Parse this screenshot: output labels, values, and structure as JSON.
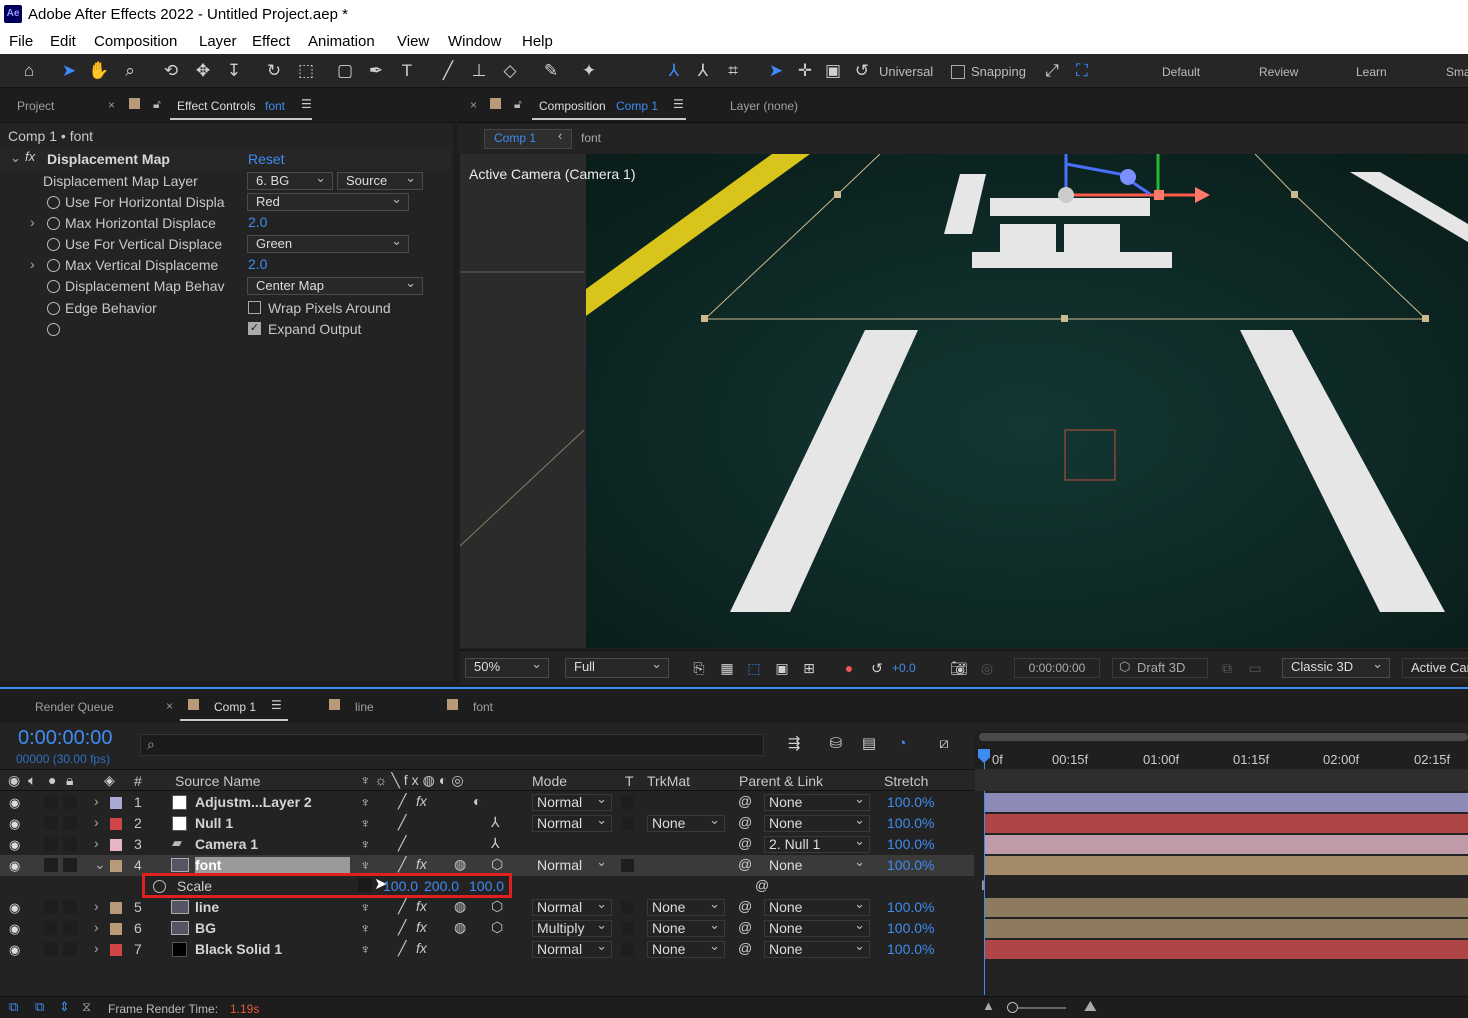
{
  "window": {
    "title": "Adobe After Effects 2022 - Untitled Project.aep *",
    "app_icon": "Ae"
  },
  "menu": [
    "File",
    "Edit",
    "Composition",
    "Layer",
    "Effect",
    "Animation",
    "View",
    "Window",
    "Help"
  ],
  "toolbar": {
    "axis_mode": "Universal",
    "snapping": "Snapping",
    "workspaces": [
      "Default",
      "Review",
      "Learn",
      "Sma"
    ]
  },
  "left_panel": {
    "tab_project": "Project",
    "tab_effect_controls": "Effect Controls",
    "tab_effect_layer": "font",
    "breadcrumb": "Comp 1 • font",
    "effect_name": "Displacement Map",
    "reset": "Reset",
    "props": [
      {
        "label": "Displacement Map Layer",
        "value": "6. BG",
        "extra": "Source"
      },
      {
        "label": "Use For Horizontal Displa",
        "value": "Red"
      },
      {
        "label": "Max Horizontal Displace",
        "value": "2.0"
      },
      {
        "label": "Use For Vertical Displace",
        "value": "Green"
      },
      {
        "label": "Max Vertical Displaceme",
        "value": "2.0"
      },
      {
        "label": "Displacement Map Behav",
        "value": "Center Map"
      },
      {
        "label": "Edge Behavior",
        "value": "Wrap Pixels Around"
      },
      {
        "label": "",
        "value": "Expand Output"
      }
    ]
  },
  "comp_panel": {
    "tab_label": "Composition",
    "tab_comp": "Comp 1",
    "layer_tab": "Layer (none)",
    "crumb_comp": "Comp 1",
    "crumb_layer": "font",
    "camera_label": "Active Camera (Camera 1)",
    "zoom": "50%",
    "resolution": "Full",
    "exposure": "+0.0",
    "timecode": "0:00:00:00",
    "draft": "Draft 3D",
    "renderer": "Classic 3D",
    "view": "Active Cam"
  },
  "timeline": {
    "tabs": [
      "Render Queue",
      "Comp 1",
      "line",
      "font"
    ],
    "timecode": "0:00:00:00",
    "frames": "00000 (30.00 fps)",
    "columns": {
      "num": "#",
      "source": "Source Name",
      "mode": "Mode",
      "t": "T",
      "trkmat": "TrkMat",
      "parent": "Parent & Link",
      "stretch": "Stretch"
    },
    "ruler": [
      "0f",
      "00:15f",
      "01:00f",
      "01:15f",
      "02:00f",
      "02:15f"
    ],
    "layers": [
      {
        "num": "1",
        "name": "Adjustm...Layer 2",
        "color": "#a9a9d6",
        "icon": "#ffffff",
        "mode": "Normal",
        "trkmat": "",
        "parent": "None",
        "stretch": "100.0%",
        "bar": "#8b8bb5"
      },
      {
        "num": "2",
        "name": "Null 1",
        "color": "#d04545",
        "icon": "#ffffff",
        "mode": "Normal",
        "trkmat": "None",
        "parent": "None",
        "stretch": "100.0%",
        "bar": "#b04545"
      },
      {
        "num": "3",
        "name": "Camera 1",
        "color": "#e7b4c4",
        "icon": "cam",
        "mode": "",
        "trkmat": "",
        "parent": "2. Null 1",
        "stretch": "100.0%",
        "bar": "#c09aa8"
      },
      {
        "num": "4",
        "name": "font",
        "color": "#b99a78",
        "icon": "img",
        "mode": "Normal",
        "trkmat": "",
        "parent": "None",
        "stretch": "100.0%",
        "bar": "#a38b6a"
      },
      {
        "num": "5",
        "name": "line",
        "color": "#b99a78",
        "icon": "img",
        "mode": "Normal",
        "trkmat": "None",
        "parent": "None",
        "stretch": "100.0%",
        "bar": "#8e7a5f"
      },
      {
        "num": "6",
        "name": "BG",
        "color": "#b99a78",
        "icon": "img",
        "mode": "Multiply",
        "trkmat": "None",
        "parent": "None",
        "stretch": "100.0%",
        "bar": "#8e7a5f"
      },
      {
        "num": "7",
        "name": "Black Solid 1",
        "color": "#d04545",
        "icon": "#000000",
        "mode": "Normal",
        "trkmat": "None",
        "parent": "None",
        "stretch": "100.0%",
        "bar": "#b04545"
      }
    ],
    "scale": {
      "label": "Scale",
      "x": "100.0",
      "y": "200.0",
      "z": "100.0"
    },
    "footer_label": "Frame Render Time:",
    "footer_value": "1.19s"
  },
  "colors": {
    "accent": "#3f8cf0",
    "highlight": "#e02020"
  }
}
